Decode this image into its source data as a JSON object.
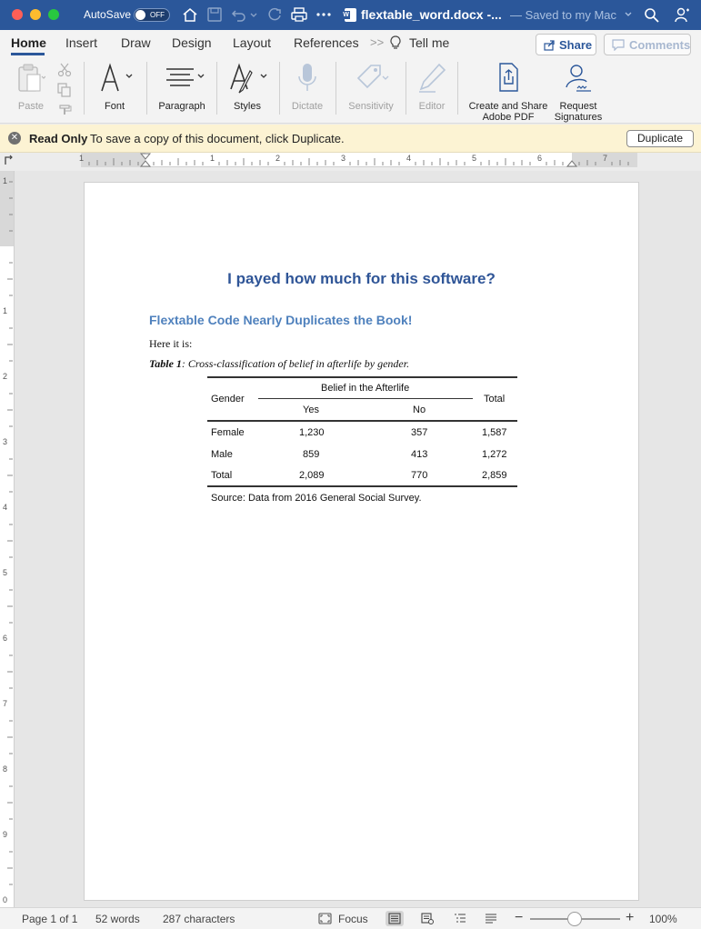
{
  "titlebar": {
    "autosave_label": "AutoSave",
    "autosave_state": "OFF",
    "filename": "flextable_word.docx -...",
    "saved_status": "— Saved to my Mac"
  },
  "ribbon": {
    "tabs": [
      "Home",
      "Insert",
      "Draw",
      "Design",
      "Layout",
      "References"
    ],
    "tell_me": "Tell me",
    "share": "Share",
    "comments": "Comments"
  },
  "toolbar": {
    "paste": "Paste",
    "font": "Font",
    "paragraph": "Paragraph",
    "styles": "Styles",
    "dictate": "Dictate",
    "sensitivity": "Sensitivity",
    "editor": "Editor",
    "create_pdf_1": "Create and Share",
    "create_pdf_2": "Adobe PDF",
    "request_sig_1": "Request",
    "request_sig_2": "Signatures"
  },
  "readonly": {
    "title": "Read Only",
    "message": "To save a copy of this document, click Duplicate.",
    "button": "Duplicate"
  },
  "ruler": {
    "h_numbers": [
      "1",
      "1",
      "2",
      "3",
      "4",
      "5",
      "6",
      "7"
    ],
    "v_numbers": [
      "1",
      "1",
      "2",
      "3",
      "4",
      "5",
      "6",
      "7",
      "8",
      "9",
      "0"
    ]
  },
  "document": {
    "title": "I payed how much for this software?",
    "heading": "Flextable Code Nearly Duplicates the Book!",
    "body": "Here it is:",
    "caption_label": "Table 1",
    "caption_text": ": Cross-classification of belief in afterlife by gender.",
    "table": {
      "col_gender": "Gender",
      "spanner": "Belief in the Afterlife",
      "col_yes": "Yes",
      "col_no": "No",
      "col_total": "Total",
      "rows": [
        [
          "Female",
          "1,230",
          "357",
          "1,587"
        ],
        [
          "Male",
          "859",
          "413",
          "1,272"
        ],
        [
          "Total",
          "2,089",
          "770",
          "2,859"
        ]
      ],
      "source": "Source: Data from 2016 General Social Survey."
    }
  },
  "statusbar": {
    "page": "Page 1 of 1",
    "words": "52 words",
    "characters": "287 characters",
    "focus": "Focus",
    "zoom": "100%"
  }
}
